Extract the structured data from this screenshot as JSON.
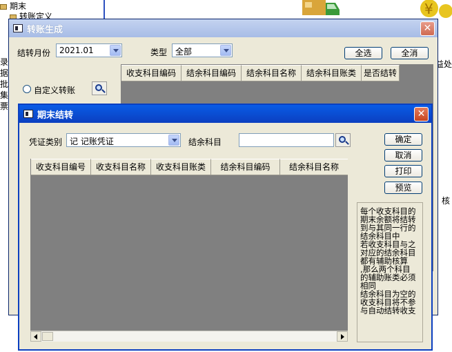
{
  "background": {
    "tree_item_1": "期末",
    "tree_item_2": "转账定义",
    "right_text_1": "益处",
    "right_text_2": "核",
    "left_text": [
      "录",
      "据",
      "批",
      "集",
      "票"
    ]
  },
  "outer_window": {
    "title": "转账生成",
    "close": "✕",
    "month_label": "结转月份",
    "month_value": "2021.01",
    "type_label": "类型",
    "type_value": "全部",
    "select_all": "全选",
    "deselect_all": "全消",
    "custom_radio_label": "自定义转账",
    "columns": [
      "收支科目编码",
      "结余科目编码",
      "结余科目名称",
      "结余科目账类",
      "是否结转"
    ]
  },
  "inner_window": {
    "title": "期末结转",
    "close": "✕",
    "voucher_label": "凭证类别",
    "voucher_value": "记 记账凭证",
    "balance_label": "结余科目",
    "balance_value": "",
    "buttons": {
      "confirm": "确定",
      "cancel": "取消",
      "print": "打印",
      "preview": "预览"
    },
    "columns": [
      "收支科目编号",
      "收支科目名称",
      "收支科目账类",
      "结余科目编码",
      "结余科目名称"
    ],
    "note": [
      "每个收支科目的",
      "期末余额将结转",
      "到与其同一行的",
      "结余科目中",
      "若收支科目与之",
      "对应的结余科目",
      "都有辅助核算",
      ",那么两个科目",
      "的辅助账类必须",
      "相同",
      "结余科目为空的",
      "收支科目将不参",
      "与自动结转收支"
    ]
  }
}
